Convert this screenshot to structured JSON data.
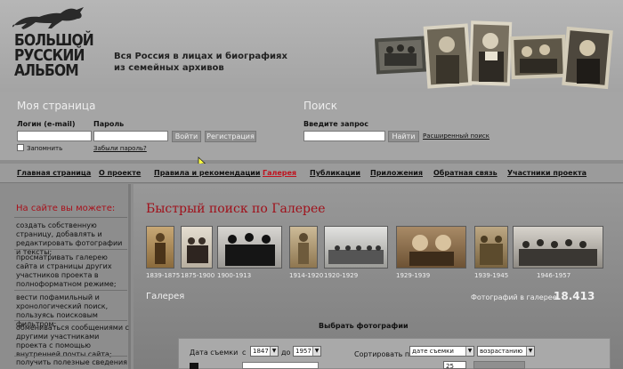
{
  "header": {
    "logo_lines": [
      "БОЛЬШОЙ",
      "РУССКИЙ",
      "АЛЬБОМ"
    ],
    "tagline_lines": [
      "Вся Россия в лицах и биографиях",
      "из семейных архивов"
    ]
  },
  "login": {
    "title": "Моя страница",
    "login_label": "Логин (e-mail)",
    "password_label": "Пароль",
    "login_button": "Войти",
    "register_button": "Регистрация",
    "remember_label": "Запомнить",
    "forgot_link": "Забыли пароль?"
  },
  "search": {
    "title": "Поиск",
    "query_label": "Введите запрос",
    "find_button": "Найти",
    "advanced_link": "Расширенный поиск"
  },
  "nav": [
    "Главная страница",
    "О проекте",
    "Правила и рекомендации",
    "Галерея",
    "Публикации",
    "Приложения",
    "Обратная связь",
    "Участники проекта"
  ],
  "nav_active": "Галерея",
  "sidebar": {
    "title": "На сайте вы можете:",
    "items": [
      "создать собственную страницу, добавлять и редактировать фотографии и тексты;",
      "просматривать галерею сайта и страницы других участников проекта в полноформатном режиме;",
      "вести пофамильный и хронологический поиск, пользуясь поисковым фильтром;",
      "обмениваться сообщениями с другими участниками проекта с помощью внутренней почты сайта;",
      "получить полезные сведения и"
    ]
  },
  "main": {
    "title": "Быстрый поиск по Галерее",
    "periods": [
      "1839-1875",
      "1875-1900",
      "1900-1913",
      "1914-1920",
      "1920-1929",
      "1929-1939",
      "1939-1945",
      "1946-1957"
    ],
    "gallery_label": "Галерея",
    "count_label": "Фотографий в галерее:",
    "count_value": "18.413",
    "filter": {
      "title": "Выбрать фотографии",
      "date_label": "Дата съемки",
      "from_label": "с",
      "from_value": "1847",
      "to_label": "до",
      "to_value": "1957",
      "sort_label": "Сортировать по",
      "sort_value": "дате съемки",
      "order_value": "возрастанию",
      "per_page_value": "25"
    }
  },
  "colors": {
    "accent_red": "#a0101a",
    "active_nav": "#c0121e"
  }
}
